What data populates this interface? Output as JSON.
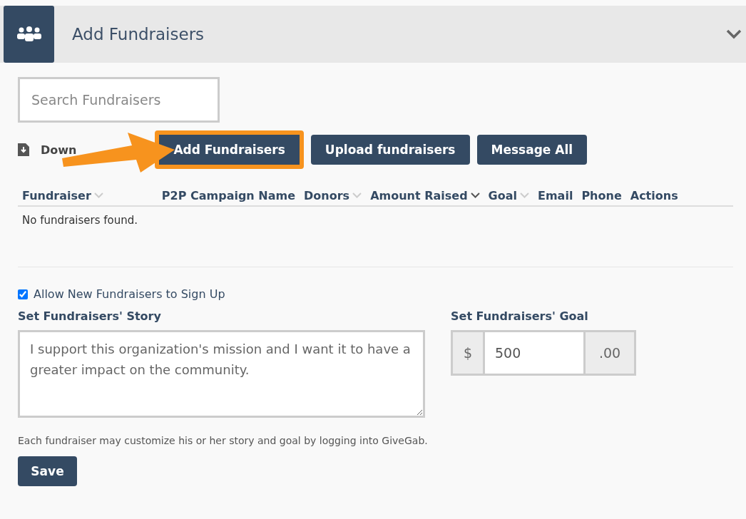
{
  "panel": {
    "title": "Add Fundraisers",
    "expanded": true
  },
  "search": {
    "placeholder": "Search Fundraisers"
  },
  "download_link": "Down",
  "buttons": [
    {
      "label": "Add Fundraisers",
      "kind": "highlighted"
    },
    {
      "label": "Upload fundraisers",
      "kind": "plain"
    },
    {
      "label": "Message All",
      "kind": "plain"
    }
  ],
  "table": {
    "columns": [
      {
        "label": "Fundraiser",
        "sortable": true,
        "sorted": false
      },
      {
        "label": "P2P Campaign Name",
        "sortable": false
      },
      {
        "label": "Donors",
        "sortable": true,
        "sorted": false
      },
      {
        "label": "Amount Raised",
        "sortable": true,
        "sorted": true
      },
      {
        "label": "Goal",
        "sortable": true,
        "sorted": false
      },
      {
        "label": "Email",
        "sortable": false
      },
      {
        "label": "Phone",
        "sortable": false
      },
      {
        "label": "Actions",
        "sortable": false
      }
    ],
    "empty_message": "No fundraisers found."
  },
  "allow_signup": {
    "label": "Allow New Fundraisers to Sign Up",
    "checked": true
  },
  "story": {
    "label": "Set Fundraisers' Story",
    "value": "I support this organization's mission and I want it to have a greater impact on the community."
  },
  "goal": {
    "label": "Set Fundraisers' Goal",
    "prefix": "$",
    "value": "500",
    "suffix": ".00"
  },
  "help_text": "Each fundraiser may customize his or her story and goal by logging into GiveGab.",
  "save_button": "Save"
}
